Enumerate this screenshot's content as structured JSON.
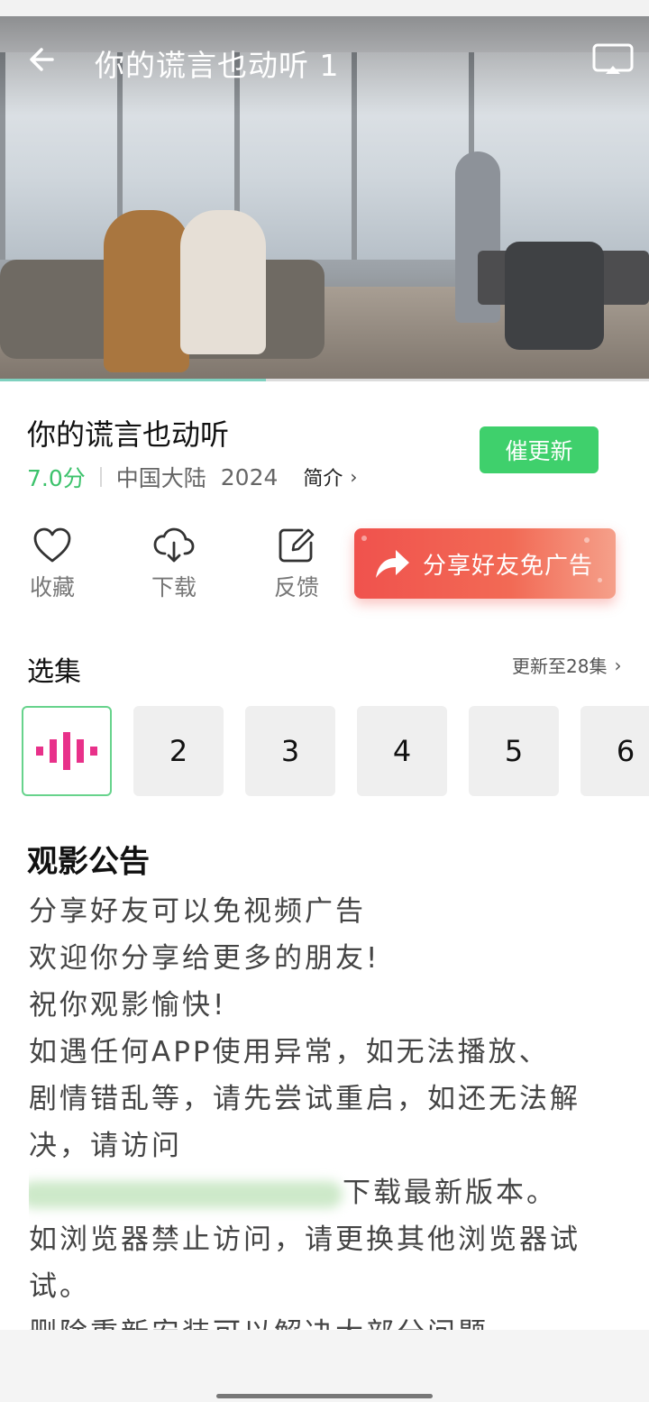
{
  "player": {
    "title": "你的谎言也动听 1",
    "back_icon": "arrow-left-icon",
    "cast_icon": "screen-cast-icon",
    "progress": 0.41
  },
  "show": {
    "title": "你的谎言也动听",
    "score": "7.0分",
    "region": "中国大陆",
    "year": "2024",
    "intro_label": "简介",
    "update_button": "催更新"
  },
  "actions": {
    "favorite": "收藏",
    "download": "下载",
    "feedback": "反馈",
    "share": "分享好友免广告"
  },
  "episodes": {
    "section_title": "选集",
    "update_status": "更新至28集",
    "items": [
      "2",
      "3",
      "4",
      "5",
      "6"
    ]
  },
  "notice": {
    "title": "观影公告",
    "lines": [
      "分享好友可以免视频广告",
      "欢迎你分享给更多的朋友!",
      "祝你观影愉快!",
      "如遇任何APP使用异常，如无法播放、",
      "剧情错乱等，请先尝试重启，如还无法解",
      "决，请访问",
      "下载最新版本。",
      "如浏览器禁止访问，请更换其他浏览器试",
      "试。",
      "删除重新安装可以解决大部分问题"
    ]
  },
  "colors": {
    "accent_green": "#3fd06c",
    "score_green": "#3cc26b",
    "share_red": "#f0524d",
    "playing_pink": "#e8318a"
  }
}
